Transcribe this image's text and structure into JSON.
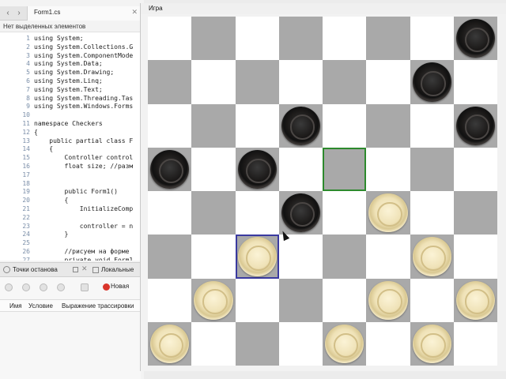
{
  "ide": {
    "tab": {
      "title": "Form1.cs",
      "close": "✕"
    },
    "nav": {
      "back": "‹",
      "forward": "›"
    },
    "selection_status": "Нет выделенных элементов",
    "code_lines": [
      {
        "n": "1",
        "text": "using System;"
      },
      {
        "n": "2",
        "text": "using System.Collections.G"
      },
      {
        "n": "3",
        "text": "using System.ComponentMode"
      },
      {
        "n": "4",
        "text": "using System.Data;"
      },
      {
        "n": "5",
        "text": "using System.Drawing;"
      },
      {
        "n": "6",
        "text": "using System.Linq;"
      },
      {
        "n": "7",
        "text": "using System.Text;"
      },
      {
        "n": "8",
        "text": "using System.Threading.Tas"
      },
      {
        "n": "9",
        "text": "using System.Windows.Forms"
      },
      {
        "n": "10",
        "text": ""
      },
      {
        "n": "11",
        "text": "namespace Checkers"
      },
      {
        "n": "12",
        "text": "{"
      },
      {
        "n": "13",
        "text": "    public partial class F"
      },
      {
        "n": "14",
        "text": "    {"
      },
      {
        "n": "15",
        "text": "        Controller control"
      },
      {
        "n": "16",
        "text": "        float size; //разм"
      },
      {
        "n": "17",
        "text": ""
      },
      {
        "n": "18",
        "text": ""
      },
      {
        "n": "19",
        "text": "        public Form1()"
      },
      {
        "n": "20",
        "text": "        {"
      },
      {
        "n": "21",
        "text": "            InitializeComp"
      },
      {
        "n": "22",
        "text": ""
      },
      {
        "n": "23",
        "text": "            controller = n"
      },
      {
        "n": "24",
        "text": "        }"
      },
      {
        "n": "25",
        "text": ""
      },
      {
        "n": "26",
        "text": "        //рисуем на форме"
      },
      {
        "n": "27",
        "text": "        private void Form1"
      }
    ],
    "breakpoints_panel": {
      "tab_breakpoints": "Точки останова",
      "tab_locals": "Локальные",
      "new_button": "Новая",
      "columns": [
        "Имя",
        "Условие",
        "Выражение трассировки"
      ]
    }
  },
  "game": {
    "menu": {
      "game": "Игра"
    },
    "board": {
      "size": 8,
      "colors": {
        "light": "#ffffff",
        "dark": "#a9a9a9",
        "selected": "#3a3aa0",
        "target": "#2d8a2d"
      },
      "selected_cell": {
        "row": 5,
        "col": 2
      },
      "target_cell": {
        "row": 3,
        "col": 4
      },
      "pieces": [
        {
          "color": "black",
          "row": 0,
          "col": 7
        },
        {
          "color": "black",
          "row": 1,
          "col": 6
        },
        {
          "color": "black",
          "row": 2,
          "col": 3
        },
        {
          "color": "black",
          "row": 2,
          "col": 7
        },
        {
          "color": "black",
          "row": 3,
          "col": 0
        },
        {
          "color": "black",
          "row": 3,
          "col": 2
        },
        {
          "color": "black",
          "row": 4,
          "col": 3
        },
        {
          "color": "white",
          "row": 4,
          "col": 5
        },
        {
          "color": "white",
          "row": 5,
          "col": 2
        },
        {
          "color": "white",
          "row": 5,
          "col": 6
        },
        {
          "color": "white",
          "row": 6,
          "col": 1
        },
        {
          "color": "white",
          "row": 6,
          "col": 5
        },
        {
          "color": "white",
          "row": 6,
          "col": 7
        },
        {
          "color": "white",
          "row": 7,
          "col": 0
        },
        {
          "color": "white",
          "row": 7,
          "col": 4
        },
        {
          "color": "white",
          "row": 7,
          "col": 6
        }
      ]
    }
  }
}
